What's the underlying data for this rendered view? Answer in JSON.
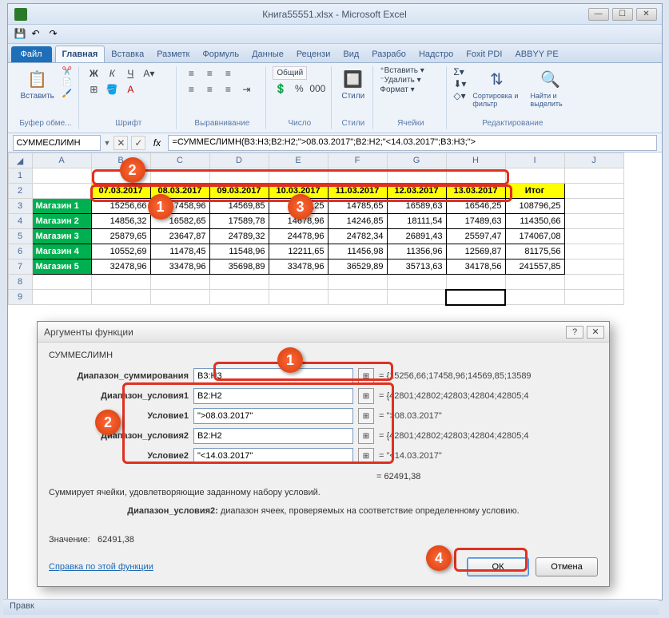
{
  "window": {
    "title": "Книга55551.xlsx - Microsoft Excel",
    "min": "—",
    "max": "☐",
    "close": "✕"
  },
  "tabs": {
    "file": "Файл",
    "items": [
      "Главная",
      "Вставка",
      "Разметк",
      "Формуль",
      "Данные",
      "Рецензи",
      "Вид",
      "Разрабо",
      "Надстро",
      "Foxit PDI",
      "ABBYY PE"
    ],
    "activeIndex": 0
  },
  "ribbon": {
    "paste": "Вставить",
    "clipboard": "Буфер обме...",
    "font": "Шрифт",
    "align": "Выравнивание",
    "number": "Число",
    "numfmt": "Общий",
    "styles": "Стили",
    "styles_btn": "Стили",
    "cells": "Ячейки",
    "cells_insert": "⁺Вставить ▾",
    "cells_delete": "⁻Удалить ▾",
    "cells_format": "Формат ▾",
    "editing": "Редактирование",
    "sort": "Сортировка и фильтр",
    "find": "Найти и выделить"
  },
  "formula": {
    "name": "СУММЕСЛИМН",
    "text": "=СУММЕСЛИМН(B3:H3;B2:H2;\">08.03.2017\";B2:H2;\"<14.03.2017\";B3:H3;\">"
  },
  "sheet": {
    "cols": [
      "A",
      "B",
      "C",
      "D",
      "E",
      "F",
      "G",
      "H",
      "I",
      "J"
    ],
    "rows": [
      "1",
      "2",
      "3",
      "4",
      "5",
      "6",
      "7",
      "8",
      "9"
    ],
    "dates": [
      "07.03.2017",
      "08.03.2017",
      "09.03.2017",
      "10.03.2017",
      "11.03.2017",
      "12.03.2017",
      "13.03.2017"
    ],
    "total_hdr": "Итог",
    "stores": [
      {
        "name": "Магазин 1",
        "vals": [
          "15256,66",
          "17458,96",
          "14569,85",
          "13589,25",
          "14785,65",
          "16589,63",
          "16546,25"
        ],
        "total": "108796,25"
      },
      {
        "name": "Магазин 2",
        "vals": [
          "14856,32",
          "16582,65",
          "17589,78",
          "14678,96",
          "14246,85",
          "18111,54",
          "17489,63"
        ],
        "total": "114350,66"
      },
      {
        "name": "Магазин 3",
        "vals": [
          "25879,65",
          "23647,87",
          "24789,32",
          "24478,96",
          "24782,34",
          "26891,43",
          "25597,47"
        ],
        "total": "174067,08"
      },
      {
        "name": "Магазин 4",
        "vals": [
          "10552,69",
          "11478,45",
          "11548,96",
          "12211,65",
          "11456,98",
          "11356,96",
          "12569,87"
        ],
        "total": "81175,56"
      },
      {
        "name": "Магазин 5",
        "vals": [
          "32478,96",
          "33478,96",
          "35698,89",
          "33478,96",
          "36529,89",
          "35713,63",
          "34178,56"
        ],
        "total": "241557,85"
      }
    ]
  },
  "dialog": {
    "title": "Аргументы функции",
    "func": "СУММЕСЛИМН",
    "args": [
      {
        "label": "Диапазон_суммирования",
        "value": "B3:H3",
        "result": "{15256,66;17458,96;14569,85;13589"
      },
      {
        "label": "Диапазон_условия1",
        "value": "B2:H2",
        "result": "{42801;42802;42803;42804;42805;4"
      },
      {
        "label": "Условие1",
        "value": "\">08.03.2017\"",
        "result": "\">08.03.2017\""
      },
      {
        "label": "Диапазон_условия2",
        "value": "B2:H2",
        "result": "{42801;42802;42803;42804;42805;4"
      },
      {
        "label": "Условие2",
        "value": "\"<14.03.2017\"",
        "result": "\"<14.03.2017\""
      }
    ],
    "result_eq": "=  62491,38",
    "desc1": "Суммирует ячейки, удовлетворяющие заданному набору условий.",
    "desc2_label": "Диапазон_условия2:",
    "desc2_text": " диапазон ячеек, проверяемых на соответствие определенному условию.",
    "value_label": "Значение:",
    "value": "62491,38",
    "help": "Справка по этой функции",
    "ok": "ОК",
    "cancel": "Отмена"
  },
  "status": "Правк",
  "callouts": {
    "c1": "1",
    "c2": "2",
    "c3": "3",
    "c4": "4",
    "d1": "1",
    "d2": "2"
  }
}
